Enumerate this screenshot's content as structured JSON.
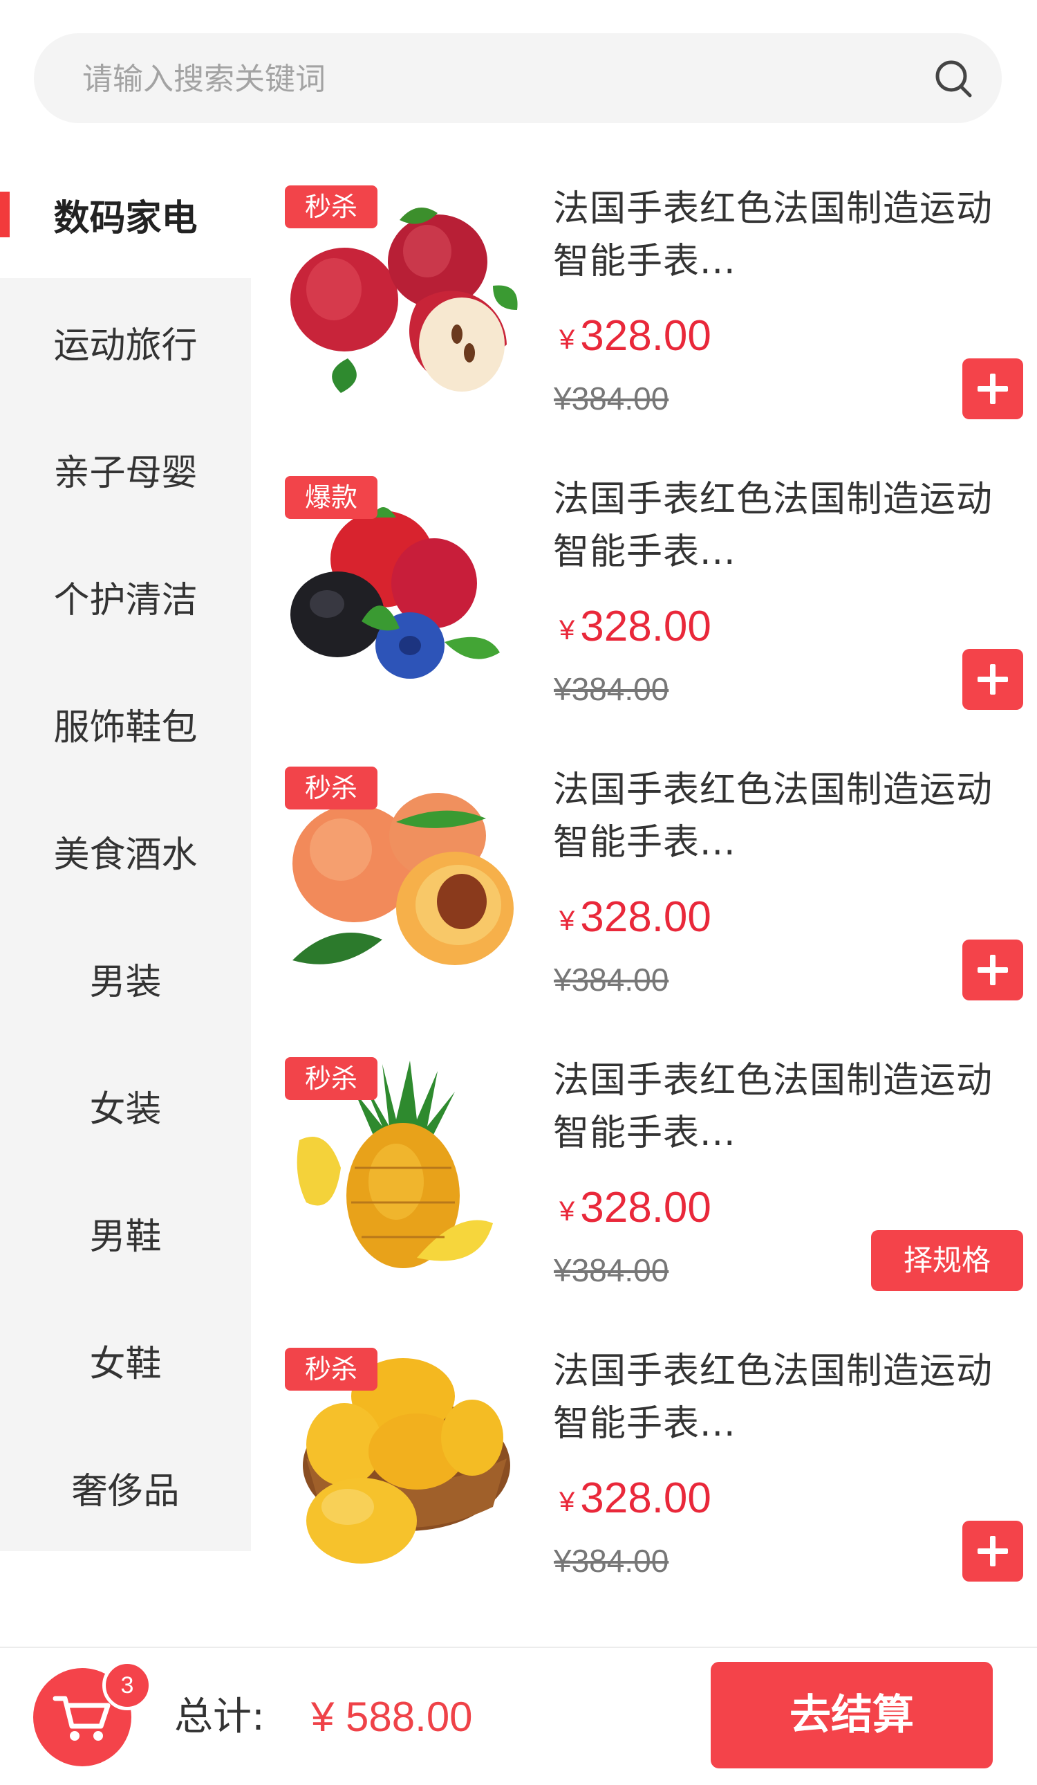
{
  "search": {
    "placeholder": "请输入搜索关键词",
    "icon": "search-icon"
  },
  "sidebar": {
    "active_index": 0,
    "items": [
      {
        "label": "数码家电"
      },
      {
        "label": "运动旅行"
      },
      {
        "label": "亲子母婴"
      },
      {
        "label": "个护清洁"
      },
      {
        "label": "服饰鞋包"
      },
      {
        "label": "美食酒水"
      },
      {
        "label": "男装"
      },
      {
        "label": "女装"
      },
      {
        "label": "男鞋"
      },
      {
        "label": "女鞋"
      },
      {
        "label": "奢侈品"
      }
    ]
  },
  "products": [
    {
      "tag": "秒杀",
      "image": "apple",
      "title": "法国手表红色法国制造运动智能手表...",
      "currency": "¥",
      "price": "328.00",
      "old_price": "¥384.00",
      "action": "add"
    },
    {
      "tag": "爆款",
      "image": "berries",
      "title": "法国手表红色法国制造运动智能手表...",
      "currency": "¥",
      "price": "328.00",
      "old_price": "¥384.00",
      "action": "add"
    },
    {
      "tag": "秒杀",
      "image": "peach",
      "title": "法国手表红色法国制造运动智能手表...",
      "currency": "¥",
      "price": "328.00",
      "old_price": "¥384.00",
      "action": "add"
    },
    {
      "tag": "秒杀",
      "image": "pineapple",
      "title": "法国手表红色法国制造运动智能手表...",
      "currency": "¥",
      "price": "328.00",
      "old_price": "¥384.00",
      "action": "spec",
      "spec_label": "择规格"
    },
    {
      "tag": "秒杀",
      "image": "mango",
      "title": "法国手表红色法国制造运动智能手表...",
      "currency": "¥",
      "price": "328.00",
      "old_price": "¥384.00",
      "action": "add"
    }
  ],
  "cart": {
    "count": "3",
    "icon": "cart-icon"
  },
  "total": {
    "label": "总计:",
    "value": "¥ 588.00"
  },
  "checkout": {
    "label": "去结算"
  },
  "colors": {
    "accent": "#f4434a",
    "price": "#e9283a",
    "sidebar_bg": "#f4f4f4",
    "search_bg": "#f4f4f4"
  }
}
